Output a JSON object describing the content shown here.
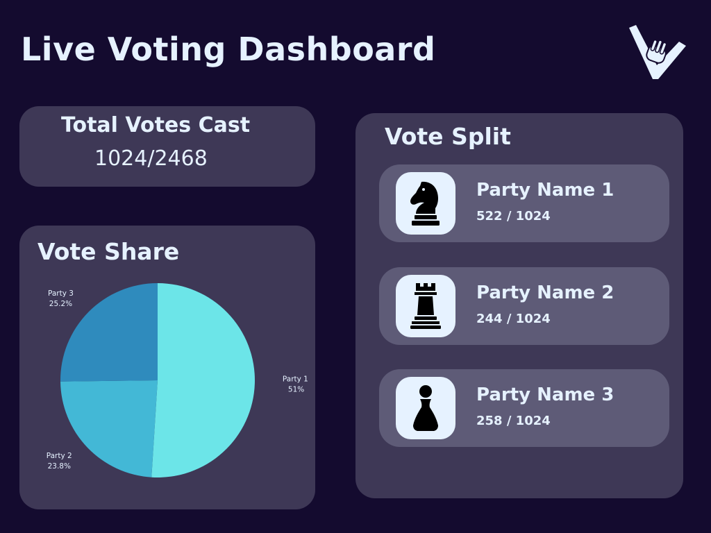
{
  "header": {
    "title": "Live Voting Dashboard",
    "logo_icon": "v-logo-icon"
  },
  "total": {
    "label": "Total Votes Cast",
    "value": "1024/2468"
  },
  "share": {
    "heading": "Vote Share"
  },
  "split": {
    "heading": "Vote Split",
    "parties": [
      {
        "name": "Party Name 1",
        "count": "522 / 1024",
        "icon": "chess-knight-icon"
      },
      {
        "name": "Party Name 2",
        "count": "244 / 1024",
        "icon": "chess-rook-icon"
      },
      {
        "name": "Party Name 3",
        "count": "258 / 1024",
        "icon": "chess-pawn-icon"
      }
    ]
  },
  "colors": {
    "background": "#140b2f",
    "card": "#3e3856",
    "party_card": "#5e5b77",
    "text": "#e6f2ff"
  },
  "chart_data": {
    "type": "pie",
    "slices": [
      {
        "label": "Party 1",
        "pct_label": "51%",
        "value": 51,
        "color": "#6ce5e8"
      },
      {
        "label": "Party 2",
        "pct_label": "23.8%",
        "value": 23.8,
        "color": "#43b8d6"
      },
      {
        "label": "Party 3",
        "pct_label": "25.2%",
        "value": 25.2,
        "color": "#2f8bbd"
      }
    ]
  }
}
